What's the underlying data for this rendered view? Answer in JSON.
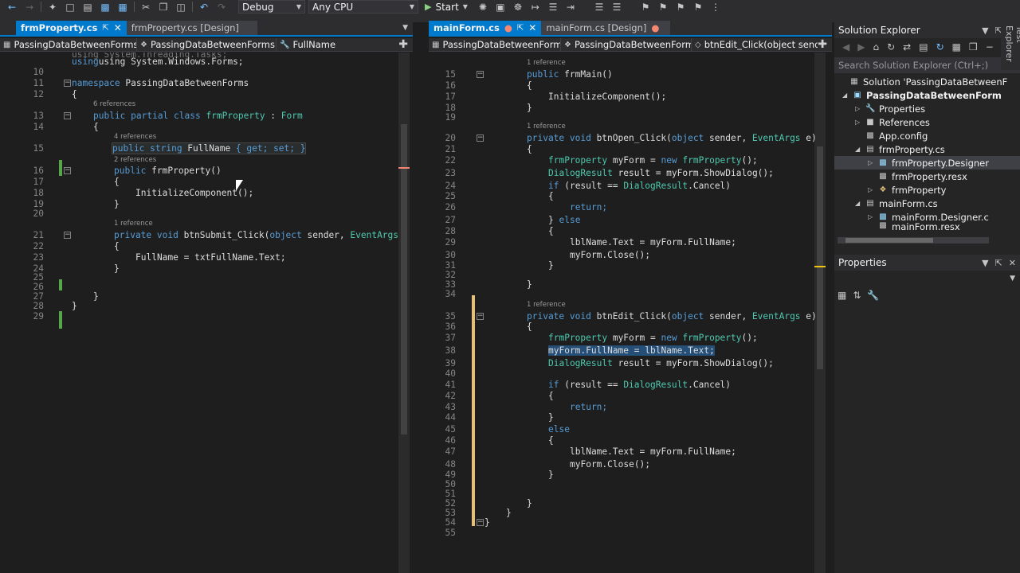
{
  "toolbar": {
    "config": "Debug",
    "platform": "Any CPU",
    "start": "Start"
  },
  "left": {
    "tabs": [
      {
        "label": "frmProperty.cs",
        "active": true
      },
      {
        "label": "frmProperty.cs [Design]",
        "active": false
      }
    ],
    "nav": {
      "project": "PassingDataBetweenForms",
      "type": "PassingDataBetweenForms.",
      "member": "FullName"
    },
    "line_numbers": [
      "",
      "10",
      "11",
      "12",
      "13",
      "14",
      "15",
      "16",
      "17",
      "18",
      "19",
      "20",
      "21",
      "22",
      "23",
      "24",
      "25",
      "26",
      "27",
      "28",
      "29"
    ],
    "lines": {
      "l0": "using System.Threading.Tasks;",
      "l9": "using System.Windows.Forms;",
      "l11a": "namespace",
      "l11b": " PassingDataBetweenForms",
      "l12": "{",
      "lens13": "6 references",
      "l13a": "public partial class",
      "l13b": "frmProperty",
      "l13c": " : ",
      "l13d": "Form",
      "l14": "{",
      "lens15": "4 references",
      "l15a": "public string",
      "l15b": " FullName ",
      "l15c": "{ get; set; }",
      "lens16": "2 references",
      "l16a": "public",
      "l16b": " frmProperty()",
      "l17": "{",
      "l18": "InitializeComponent();",
      "l19": "}",
      "lens21": "1 reference",
      "l21a": "private void",
      "l21b": " btnSubmit_Click(",
      "l21c": "object",
      "l21d": " sender, ",
      "l21e": "EventArgs",
      "l22": "{",
      "l23": "FullName = txtFullName.Text;",
      "l24": "}",
      "l27": "}",
      "l28": "}"
    }
  },
  "right": {
    "tabs": [
      {
        "label": "mainForm.cs",
        "active": true
      },
      {
        "label": "mainForm.cs [Design]",
        "active": false
      }
    ],
    "nav": {
      "project": "PassingDataBetweenForms",
      "type": "PassingDataBetweenForms.",
      "member": "btnEdit_Click(object sender,"
    },
    "line_numbers": [
      "15",
      "16",
      "17",
      "18",
      "19",
      "20",
      "21",
      "22",
      "23",
      "24",
      "25",
      "26",
      "27",
      "28",
      "29",
      "30",
      "31",
      "32",
      "33",
      "34",
      "35",
      "36",
      "37",
      "38",
      "39",
      "40",
      "41",
      "42",
      "43",
      "44",
      "45",
      "46",
      "47",
      "48",
      "49",
      "50",
      "51",
      "52",
      "53",
      "54",
      "55"
    ],
    "lines": {
      "lens15": "1 reference",
      "r15a": "public",
      "r15b": " frmMain()",
      "r16": "{",
      "r17": "InitializeComponent();",
      "r18": "}",
      "lens20": "1 reference",
      "r20a": "private void",
      "r20b": " btnOpen_Click(",
      "r20c": "object",
      "r20d": " sender, ",
      "r20e": "EventArgs",
      "r20f": " e)",
      "r21": "{",
      "r22a": "frmProperty",
      "r22b": " myForm = ",
      "r22c": "new",
      "r22d": " frmProperty",
      "r22e": "();",
      "r23a": "DialogResult",
      "r23b": " result = myForm.ShowDialog();",
      "r24a": "if",
      "r24b": " (result == ",
      "r24c": "DialogResult",
      "r24d": ".Cancel)",
      "r25": "{",
      "r26": "return;",
      "r27a": "} ",
      "r27b": "else",
      "r28": "{",
      "r29": "lblName.Text = myForm.FullName;",
      "r30": "myForm.Close();",
      "r31": "}",
      "r33": "}",
      "lens35": "1 reference",
      "r35a": "private void",
      "r35b": " btnEdit_Click(",
      "r35c": "object",
      "r35d": " sender, ",
      "r35e": "EventArgs",
      "r35f": " e)",
      "r36": "{",
      "r37a": "frmProperty",
      "r37b": " myForm = ",
      "r37c": "new",
      "r37d": " frmProperty",
      "r37e": "();",
      "r38": "myForm.FullName = lblName.Text;",
      "r39a": "DialogResult",
      "r39b": " result = myForm.ShowDialog();",
      "r41a": "if",
      "r41b": " (result == ",
      "r41c": "DialogResult",
      "r41d": ".Cancel)",
      "r42": "{",
      "r43": "return;",
      "r44": "}",
      "r45": "else",
      "r46": "{",
      "r47": "lblName.Text = myForm.FullName;",
      "r48": "myForm.Close();",
      "r49": "}",
      "r52": "}",
      "r53": "}",
      "r54": "}"
    }
  },
  "solution_explorer": {
    "title": "Solution Explorer",
    "search_placeholder": "Search Solution Explorer (Ctrl+;)",
    "items": [
      {
        "label": "Solution 'PassingDataBetweenF"
      },
      {
        "label": "PassingDataBetweenForm"
      },
      {
        "label": "Properties"
      },
      {
        "label": "References"
      },
      {
        "label": "App.config"
      },
      {
        "label": "frmProperty.cs"
      },
      {
        "label": "frmProperty.Designer"
      },
      {
        "label": "frmProperty.resx"
      },
      {
        "label": "frmProperty"
      },
      {
        "label": "mainForm.cs"
      },
      {
        "label": "mainForm.Designer.c"
      },
      {
        "label": "mainForm.resx"
      }
    ]
  },
  "properties": {
    "title": "Properties"
  },
  "side_rail": {
    "label": "Test Explorer"
  },
  "colors": {
    "accent": "#007acc",
    "keyword": "#569cd6",
    "type": "#4ec9b0",
    "selection": "#264f78"
  }
}
